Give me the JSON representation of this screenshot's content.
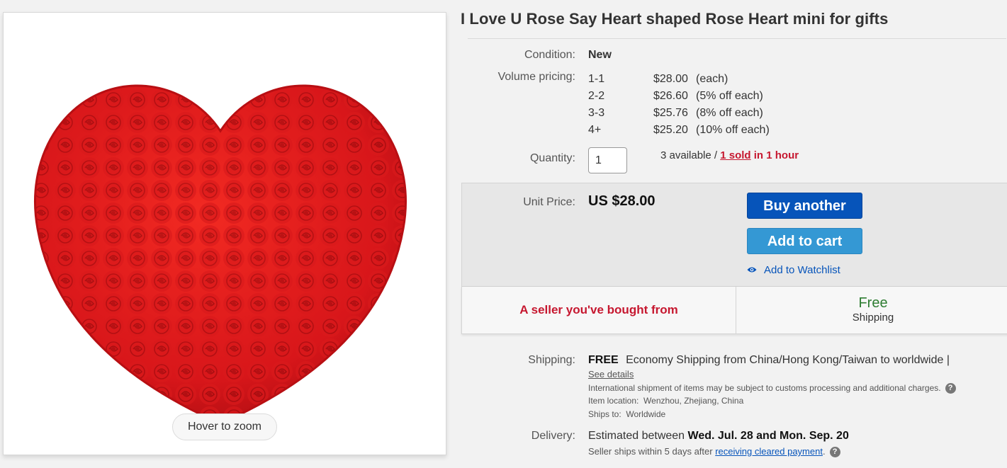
{
  "product": {
    "title": "I Love U Rose Say Heart shaped Rose Heart mini for gifts",
    "image_alt": "Red heart made of foam roses",
    "zoom_hint": "Hover to zoom"
  },
  "condition": {
    "label": "Condition:",
    "value": "New"
  },
  "volume_pricing": {
    "label": "Volume pricing:",
    "tiers": [
      {
        "range": "1-1",
        "price": "$28.00",
        "note": "(each)"
      },
      {
        "range": "2-2",
        "price": "$26.60",
        "note": "(5% off each)"
      },
      {
        "range": "3-3",
        "price": "$25.76",
        "note": "(8% off each)"
      },
      {
        "range": "4+",
        "price": "$25.20",
        "note": "(10% off each)"
      }
    ]
  },
  "quantity": {
    "label": "Quantity:",
    "value": "1",
    "available_text": "3 available / ",
    "sold_text": "1 sold",
    "sold_suffix": " in 1 hour"
  },
  "price_box": {
    "unit_label": "Unit Price:",
    "unit_price": "US $28.00",
    "buy_button": "Buy another",
    "cart_button": "Add to cart",
    "watchlist_link": "Add to Watchlist"
  },
  "badges": {
    "seller": "A seller you've bought from",
    "shipping_top": "Free",
    "shipping_bottom": "Shipping"
  },
  "shipping": {
    "label": "Shipping:",
    "free": "FREE",
    "description": "Economy Shipping from China/Hong Kong/Taiwan to worldwide |",
    "see_details": "See details",
    "customs_note": "International shipment of items may be subject to customs processing and additional charges.",
    "location_label": "Item location:",
    "location": "Wenzhou, Zhejiang, China",
    "ships_to_label": "Ships to:",
    "ships_to": "Worldwide"
  },
  "delivery": {
    "label": "Delivery:",
    "prefix": "Estimated between ",
    "dates": "Wed. Jul. 28 and Mon. Sep. 20",
    "note_prefix": "Seller ships within 5 days after ",
    "note_link": "receiving cleared payment",
    "note_suffix": "."
  },
  "colors": {
    "accent_blue": "#0654ba",
    "light_blue": "#3498d4",
    "seller_red": "#c6172f",
    "free_green": "#2e7d32",
    "rose_red": "#e0191a"
  },
  "icons": [
    "eye-icon",
    "help-icon"
  ]
}
